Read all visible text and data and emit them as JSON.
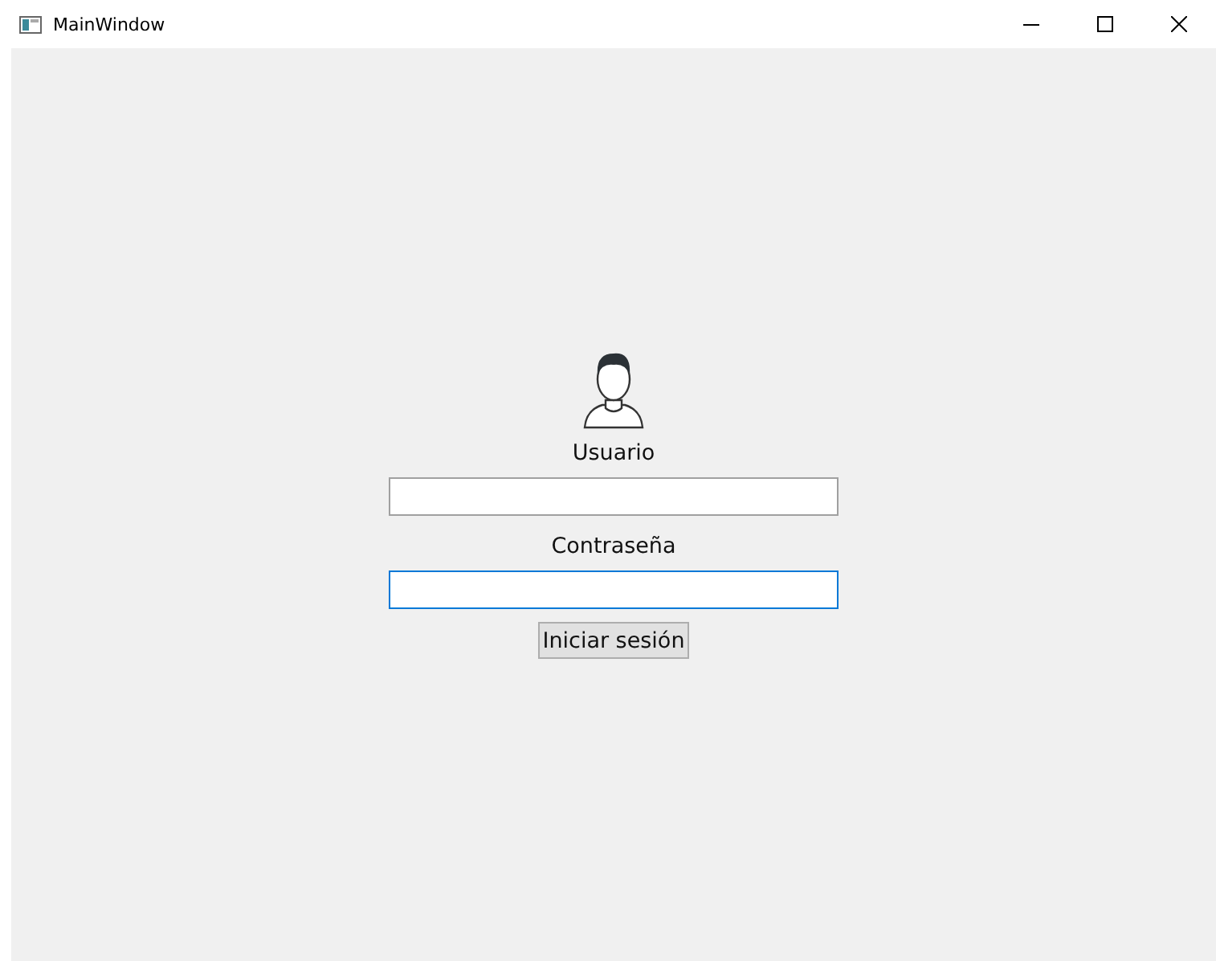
{
  "window": {
    "title": "MainWindow"
  },
  "form": {
    "fields": [
      {
        "label": "Usuario",
        "focused": false
      },
      {
        "label": "Contraseña",
        "focused": true
      }
    ],
    "button": "Iniciar sesión"
  }
}
